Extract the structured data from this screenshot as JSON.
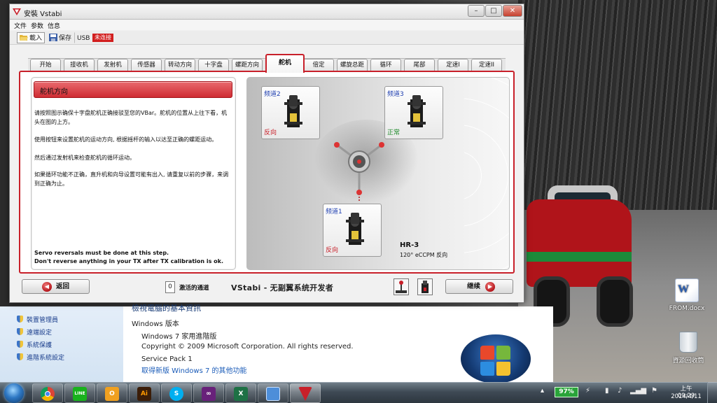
{
  "window": {
    "title": "安裝 Vstabi",
    "controls": {
      "minimize": "–",
      "maximize": "□",
      "close": "✕"
    }
  },
  "menu": [
    "文件",
    "参数",
    "信息"
  ],
  "toolbar": {
    "load": "載入",
    "save": "保存",
    "usb": "USB",
    "usb_state": "未连接"
  },
  "tabs": [
    "开始",
    "接收机",
    "发射机",
    "传感器",
    "转动方向",
    "十字盘",
    "螺距方向",
    "舵机",
    "倍定",
    "螺旋总距",
    "循环",
    "尾部",
    "定速I",
    "定速II"
  ],
  "active_tab_index": 7,
  "panel": {
    "title": "舵机方向",
    "p1": "请按照图示确保十字盘舵机正确接驳至您的VBar。舵机的位置从上往下看，机头在图的上方。",
    "p2": "使用按钮来设置舵机的运动方向, 根据摇杆的输入以达至正确的螺距运动。",
    "p3": "然后通过发射机来检查舵机的循环运动。",
    "p4": "如果循环功能不正确，直升机和向导设置可能有出入, 请重复以前的步骤，来调到正确为止。",
    "note1": "Servo reversals must be done at this step.",
    "note2": "Don't reverse anything in your TX after TX calibration is ok."
  },
  "servos": [
    {
      "channel": "频道2",
      "direction": "反向",
      "dir_color": "#c8202a"
    },
    {
      "channel": "频道3",
      "direction": "正常",
      "dir_color": "#1e8a2a"
    },
    {
      "channel": "频道1",
      "direction": "反向",
      "dir_color": "#c8202a"
    }
  ],
  "model": {
    "name": "HR-3",
    "sub": "120° eCCPM 反向"
  },
  "bottom": {
    "back": "返回",
    "next": "继续",
    "counter": "0",
    "counter_label": "激活的通道",
    "brand": "VStabi - 无副翼系统开发者"
  },
  "sysprops": {
    "heading": "檢視電腦的基本資訊",
    "links": [
      "裝置管理員",
      "遠端設定",
      "系統保護",
      "進階系統設定"
    ],
    "edition_label": "Windows 版本",
    "edition": "Windows 7 家用進階版",
    "copyright": "Copyright © 2009 Microsoft Corporation.  All rights reserved.",
    "sp": "Service Pack 1",
    "sp_link": "取得新版 Windows 7 的其他功能"
  },
  "desktop": {
    "icons": [
      "FROM.docx",
      "資源回收筒"
    ]
  },
  "taskbar": {
    "apps": [
      "chrome",
      "LINE",
      "outlook",
      "Ai",
      "skype",
      "visual-studio",
      "excel",
      "remote-desktop",
      "vstabi"
    ],
    "battery": "97%",
    "time": "上午 09:29",
    "date": "2014/4/11"
  },
  "colors": {
    "accent": "#c8202a",
    "link": "#1a3e8c"
  }
}
